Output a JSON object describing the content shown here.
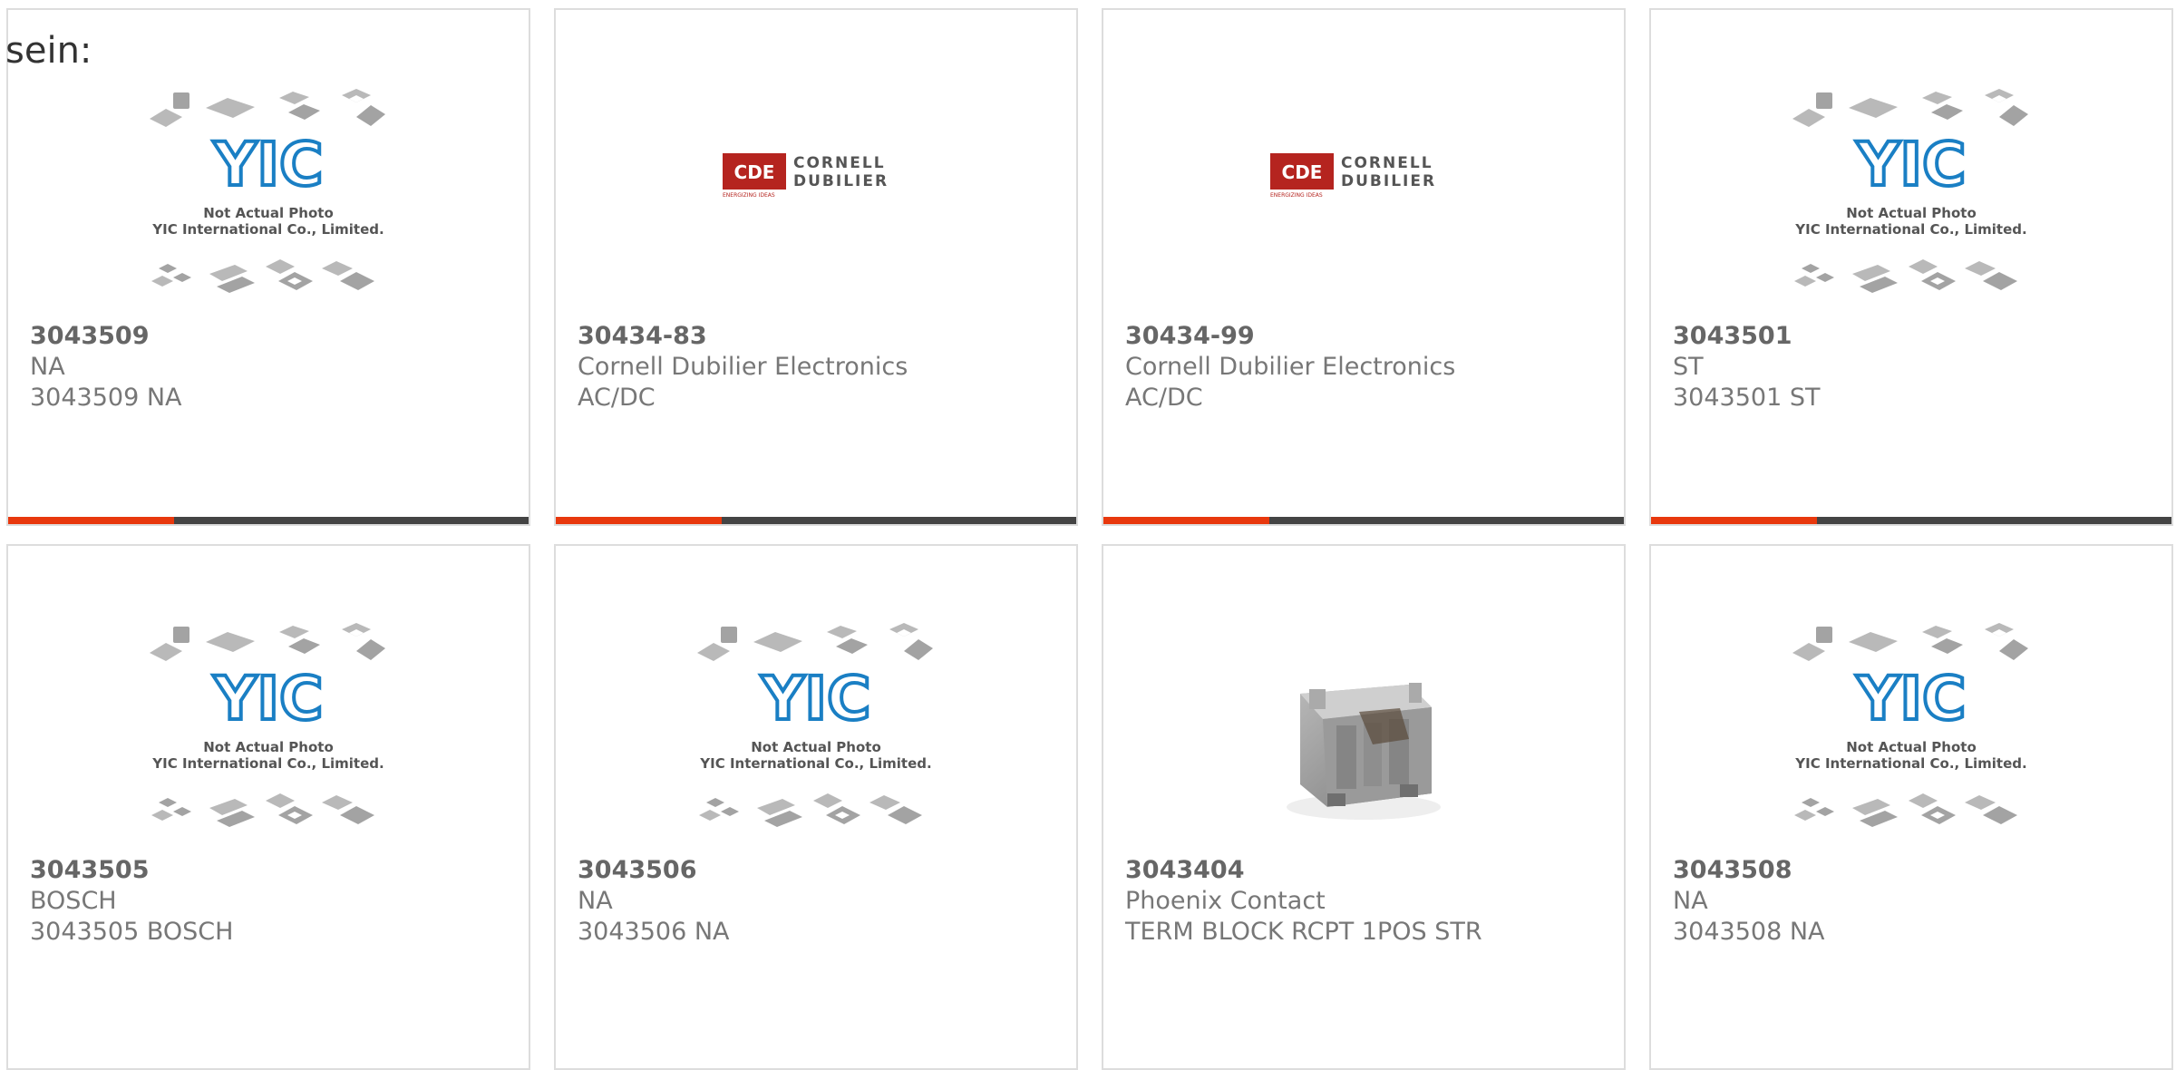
{
  "intro_text": "sein:",
  "placeholder": {
    "caption_line1": "Not Actual Photo",
    "caption_line2": "YIC International Co., Limited."
  },
  "cdl_logo": {
    "mark": "CDE",
    "word1": "CORNELL",
    "word2": "DUBILIER",
    "tagline": "ENERGIZING IDEAS"
  },
  "products": [
    {
      "part_number": "3043509",
      "manufacturer": "NA",
      "description": "3043509 NA",
      "image": "placeholder"
    },
    {
      "part_number": "30434-83",
      "manufacturer": "Cornell Dubilier Electronics",
      "description": "AC/DC",
      "image": "cde-logo"
    },
    {
      "part_number": "30434-99",
      "manufacturer": "Cornell Dubilier Electronics",
      "description": "AC/DC",
      "image": "cde-logo"
    },
    {
      "part_number": "3043501",
      "manufacturer": "ST",
      "description": "3043501 ST",
      "image": "placeholder"
    },
    {
      "part_number": "3043505",
      "manufacturer": "BOSCH",
      "description": "3043505 BOSCH",
      "image": "placeholder"
    },
    {
      "part_number": "3043506",
      "manufacturer": "NA",
      "description": "3043506 NA",
      "image": "placeholder"
    },
    {
      "part_number": "3043404",
      "manufacturer": "Phoenix Contact",
      "description": "TERM BLOCK RCPT 1POS STR",
      "image": "terminal-block"
    },
    {
      "part_number": "3043508",
      "manufacturer": "NA",
      "description": "3043508 NA",
      "image": "placeholder"
    }
  ],
  "colors": {
    "accent": "#e8380d",
    "bar_dark": "#444444",
    "border": "#dddddd",
    "logo_blue": "#1a7fc4",
    "cde_red": "#b5241f"
  }
}
